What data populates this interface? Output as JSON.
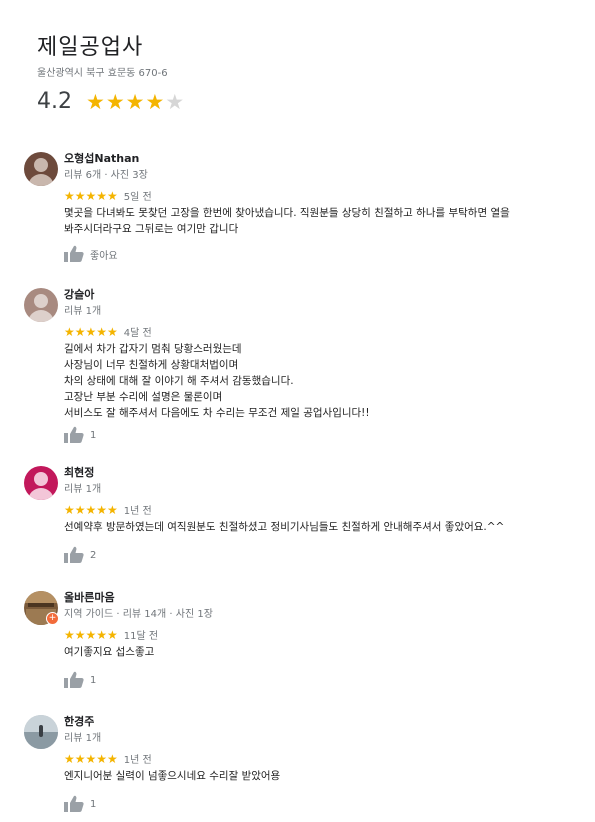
{
  "place": {
    "name": "제일공업사",
    "address": "울산광역시 북구 효문동 670-6",
    "rating": "4.2",
    "stars_filled": 4,
    "stars_total": 5
  },
  "reviews": [
    {
      "name": "오형섭Nathan",
      "meta": "리뷰 6개 · 사진 3장",
      "stars": "★★★★★",
      "time": "5일 전",
      "text": "몇곳을 다녀봐도 못찾던 고장을 한번에 찾아냈습니다. 직원분들 상당히 친절하고 하나를 부탁하면 열을\n봐주시더라구요 그뒤로는 여기만 갑니다",
      "like": "좋아요"
    },
    {
      "name": "강슬아",
      "meta": "리뷰 1개",
      "stars": "★★★★★",
      "time": "4달 전",
      "text": "길에서 차가 갑자기 멈춰 당황스러웠는데\n사장님이 너무 친절하게 상황대처법이며\n차의 상태에 대해 잘 이야기 해 주셔서 감동했습니다.\n고장난 부분 수리에 설명은 물론이며\n서비스도 잘 해주셔서 다음에도 차 수리는 무조건 제일 공업사입니다!!",
      "like": "1"
    },
    {
      "name": "최현정",
      "meta": "리뷰 1개",
      "stars": "★★★★★",
      "time": "1년 전",
      "text": "선예약후 방문하였는데 여직원분도 친절하셨고 정비기사님들도 친절하게 안내해주셔서 좋았어요.^^",
      "like": "2"
    },
    {
      "name": "올바른마음",
      "meta": "지역 가이드 · 리뷰 14개 · 사진 1장",
      "stars": "★★★★★",
      "time": "11달 전",
      "text": "여기좋지요 섭스좋고",
      "like": "1"
    },
    {
      "name": "한경주",
      "meta": "리뷰 1개",
      "stars": "★★★★★",
      "time": "1년 전",
      "text": "엔지니어분 실력이 넘좋으시네요  수리잘 받았어용",
      "like": "1"
    }
  ]
}
